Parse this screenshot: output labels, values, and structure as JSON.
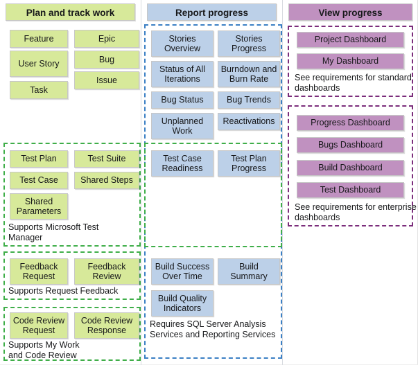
{
  "columns": [
    {
      "id": "plan-and-track-work",
      "title": "Plan and track work",
      "accent": "#d7e99a",
      "groups": [
        {
          "id": "work-items",
          "framed": false,
          "nodes": [
            {
              "label": "Feature"
            },
            {
              "label": "Epic"
            },
            {
              "label": "User\nStory"
            },
            {
              "label": "Bug"
            },
            {
              "label": "Issue"
            },
            {
              "label": "Task"
            }
          ],
          "caption": ""
        },
        {
          "id": "test-artifacts",
          "framed": true,
          "frame_color": "#3fae49",
          "nodes": [
            {
              "label": "Test Plan"
            },
            {
              "label": "Test Suite"
            },
            {
              "label": "Test Case"
            },
            {
              "label": "Shared Steps"
            },
            {
              "label": "Shared\nParameters"
            }
          ],
          "caption": "Supports Microsoft Test\nManager"
        },
        {
          "id": "feedback",
          "framed": true,
          "frame_color": "#3fae49",
          "nodes": [
            {
              "label": "Feedback\nRequest"
            },
            {
              "label": "Feedback\nReview"
            }
          ],
          "caption": "Supports Request Feedback"
        },
        {
          "id": "code-review",
          "framed": true,
          "frame_color": "#3fae49",
          "nodes": [
            {
              "label": "Code Review\nRequest"
            },
            {
              "label": "Code Review\nResponse"
            }
          ],
          "caption": "Supports My Work\nand Code Review"
        }
      ]
    },
    {
      "id": "report-progress",
      "title": "Report progress",
      "accent": "#bcd0e8",
      "groups": [
        {
          "id": "agile-reports",
          "framed": true,
          "frame_color": "#3a7fc4",
          "nodes": [
            {
              "label": "Stories\nOverview"
            },
            {
              "label": "Stories\nProgress"
            },
            {
              "label": "Status of All\nIterations"
            },
            {
              "label": "Burndown and\nBurn Rate"
            },
            {
              "label": "Bug Status"
            },
            {
              "label": "Bug Trends"
            },
            {
              "label": "Unplanned\nWork"
            },
            {
              "label": "Reactivations"
            }
          ],
          "caption": ""
        },
        {
          "id": "test-reports",
          "framed": true,
          "frame_color": "#3fae49",
          "nodes": [
            {
              "label": "Test Case\nReadiness"
            },
            {
              "label": "Test Plan\nProgress"
            }
          ],
          "caption": ""
        },
        {
          "id": "build-reports",
          "framed": false,
          "nodes": [
            {
              "label": "Build Success\nOver Time"
            },
            {
              "label": "Build\nSummary"
            },
            {
              "label": "Build Quality\nIndicators"
            }
          ],
          "caption": "Requires SQL Server Analysis\nServices and Reporting Services"
        }
      ]
    },
    {
      "id": "view-progress",
      "title": "View progress",
      "accent": "#c091c0",
      "groups": [
        {
          "id": "standard-dashboards",
          "framed": true,
          "frame_color": "#7b2d7b",
          "nodes": [
            {
              "label": "Project Dashboard"
            },
            {
              "label": "My Dashboard"
            }
          ],
          "caption": "See requirements for standard\ndashboards"
        },
        {
          "id": "enterprise-dashboards",
          "framed": true,
          "frame_color": "#7b2d7b",
          "nodes": [
            {
              "label": "Progress Dashboard"
            },
            {
              "label": "Bugs Dashboard"
            },
            {
              "label": "Build Dashboard"
            },
            {
              "label": "Test Dashboard"
            }
          ],
          "caption": "See requirements for enterprise\ndashboards"
        }
      ]
    }
  ],
  "left": {
    "title": "Plan and track work",
    "n": {
      "feature": "Feature",
      "epic": "Epic",
      "user_story": "User\nStory",
      "bug": "Bug",
      "issue": "Issue",
      "task": "Task",
      "test_plan": "Test Plan",
      "test_suite": "Test Suite",
      "test_case": "Test Case",
      "shared_steps": "Shared Steps",
      "shared_parameters": "Shared\nParameters",
      "feedback_request": "Feedback\nRequest",
      "feedback_review": "Feedback\nReview",
      "code_review_request": "Code Review\nRequest",
      "code_review_response": "Code Review\nResponse"
    },
    "cap": {
      "test": "Supports Microsoft Test\nManager",
      "feedback": "Supports Request Feedback",
      "code_review": "Supports My Work\nand Code Review"
    }
  },
  "mid": {
    "title": "Report progress",
    "n": {
      "stories_overview": "Stories\nOverview",
      "stories_progress": "Stories\nProgress",
      "status_all_iterations": "Status of All\nIterations",
      "burndown_burn_rate": "Burndown and\nBurn Rate",
      "bug_status": "Bug Status",
      "bug_trends": "Bug Trends",
      "unplanned_work": "Unplanned\nWork",
      "reactivations": "Reactivations",
      "test_case_readiness": "Test Case\nReadiness",
      "test_plan_progress": "Test Plan\nProgress",
      "build_success_over_time": "Build Success\nOver Time",
      "build_summary": "Build\nSummary",
      "build_quality_indicators": "Build Quality\nIndicators"
    },
    "cap": {
      "build": "Requires SQL Server Analysis\nServices and Reporting Services"
    }
  },
  "right": {
    "title": "View progress",
    "n": {
      "project_dashboard": "Project Dashboard",
      "my_dashboard": "My Dashboard",
      "progress_dashboard": "Progress Dashboard",
      "bugs_dashboard": "Bugs Dashboard",
      "build_dashboard": "Build Dashboard",
      "test_dashboard": "Test Dashboard"
    },
    "cap": {
      "standard": "See requirements for standard\ndashboards",
      "enterprise": "See requirements for enterprise\ndashboards"
    }
  }
}
